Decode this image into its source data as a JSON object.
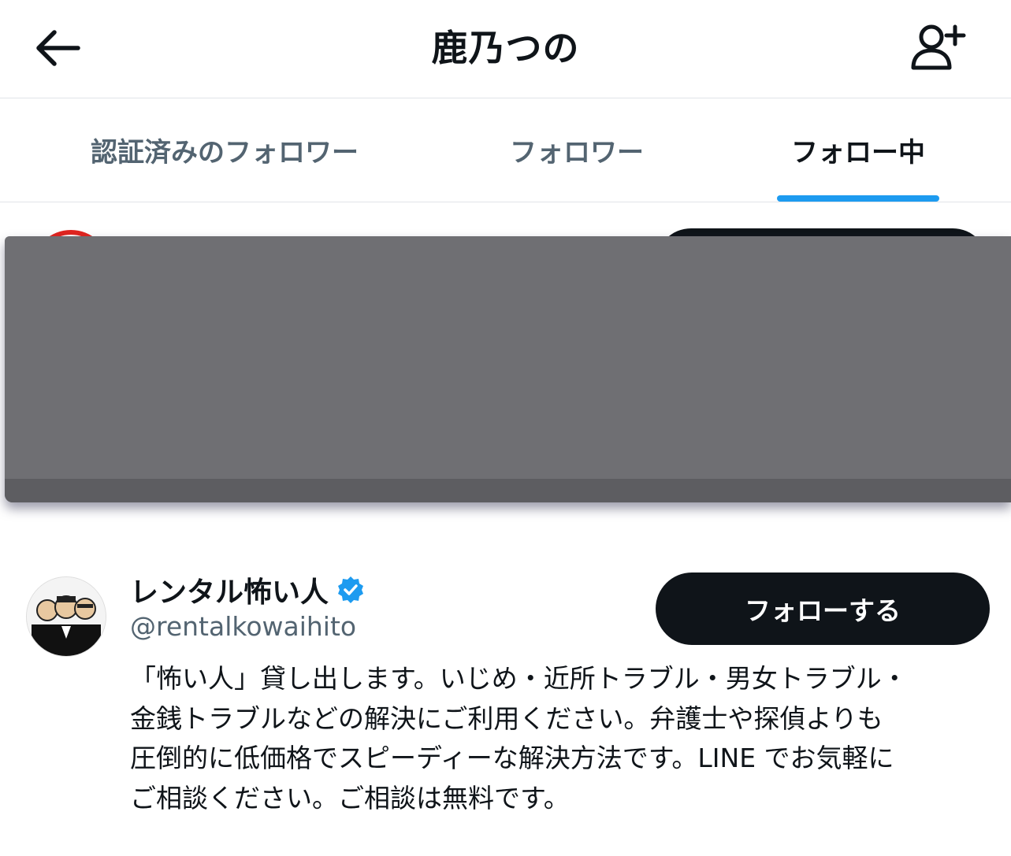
{
  "header": {
    "title": "鹿乃つの",
    "back_icon": "arrow-left-icon",
    "add_user_icon": "person-plus-icon"
  },
  "tabs": [
    {
      "label": "認証済みのフォロワー",
      "active": false
    },
    {
      "label": "フォロワー",
      "active": false
    },
    {
      "label": "フォロー中",
      "active": true
    }
  ],
  "accent_color": "#1d9bf0",
  "users": [
    {
      "name": "レンタル怖い人",
      "verified": true,
      "handle": "@rentalkowaihito",
      "follow_label": "フォローする",
      "bio_lines": [
        "「怖い人」貸し出します。いじめ・近所トラブル・男女トラブル・",
        "金銭トラブルなどの解決にご利用ください。弁護士や探偵よりも",
        "圧倒的に低価格でスピーディーな解決方法です。LINE でお気軽に",
        "ご相談ください。ご相談は無料です。"
      ]
    }
  ]
}
